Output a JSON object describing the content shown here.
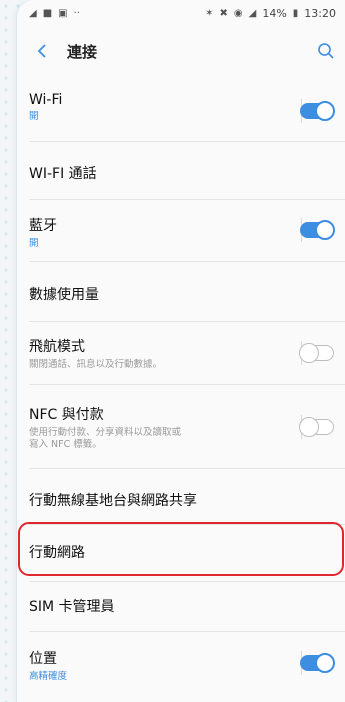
{
  "status_bar": {
    "left_icons": [
      "navigation-icon",
      "message-icon",
      "gallery-icon",
      "more-icon"
    ],
    "battery": "14%",
    "time": "13:20"
  },
  "header": {
    "title": "連接"
  },
  "items": [
    {
      "label": "Wi-Fi",
      "sub": "開",
      "toggle": "on"
    },
    {
      "label": "WI-FI 通話"
    },
    {
      "label": "藍牙",
      "sub": "開",
      "toggle": "on"
    },
    {
      "label": "數據使用量"
    },
    {
      "label": "飛航模式",
      "sub": "關閉通話、訊息以及行動數據。",
      "toggle": "off"
    },
    {
      "label": "NFC 與付款",
      "sub_line1": "使用行動付款、分享資料以及讀取或",
      "sub_line2": "寫入 NFC 標籤。",
      "toggle": "off"
    },
    {
      "label": "行動無線基地台與網路共享"
    },
    {
      "label": "行動網路"
    },
    {
      "label": "SIM 卡管理員"
    },
    {
      "label": "位置",
      "sub": "高精確度",
      "toggle": "on"
    }
  ],
  "colors": {
    "accent": "#3d8de0",
    "highlight": "#e0262e"
  }
}
